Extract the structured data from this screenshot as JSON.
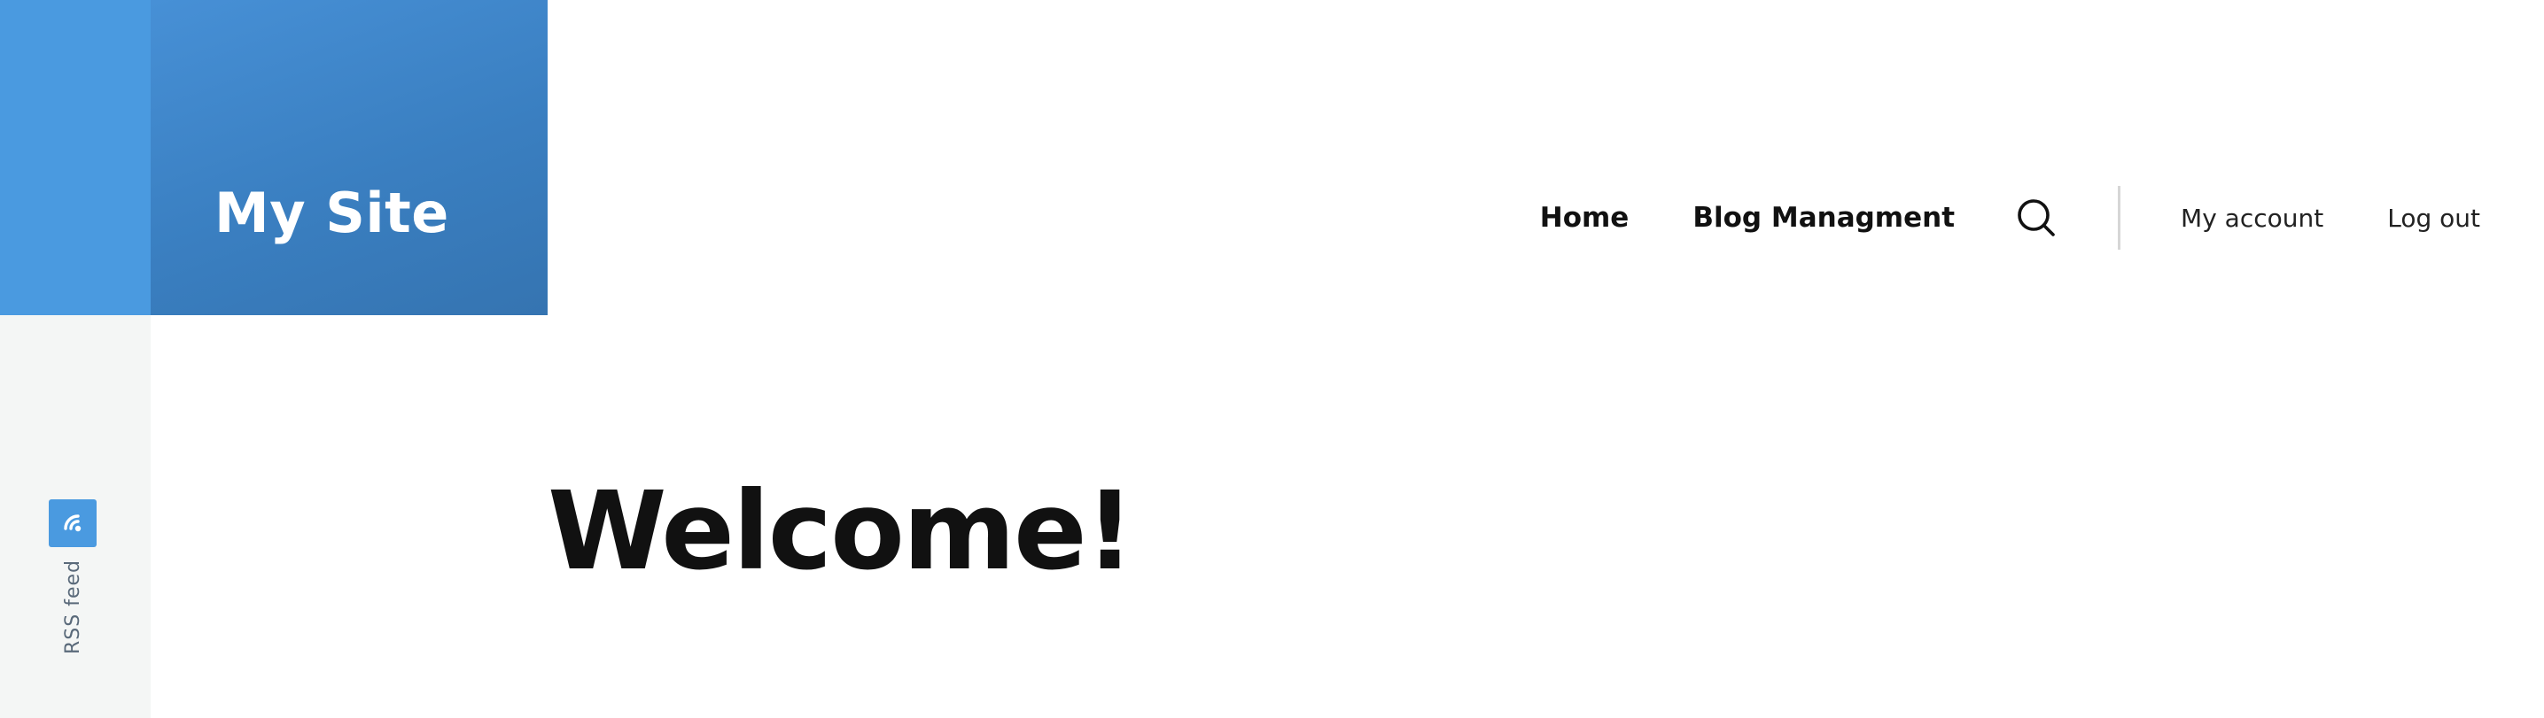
{
  "site": {
    "title": "My Site"
  },
  "nav": {
    "primary": [
      {
        "label": "Home"
      },
      {
        "label": "Blog Managment"
      }
    ],
    "search_icon": "search-icon",
    "account": [
      {
        "label": "My account"
      },
      {
        "label": "Log out"
      }
    ]
  },
  "sidebar": {
    "rss_label": "RSS feed",
    "rss_icon": "rss-icon"
  },
  "main": {
    "heading": "Welcome!"
  },
  "colors": {
    "accent": "#4a9ae0",
    "brand_gradient_start": "#4790d6",
    "brand_gradient_end": "#3574b1",
    "text_dark": "#111111",
    "sidebar_bg": "#f4f6f5"
  }
}
